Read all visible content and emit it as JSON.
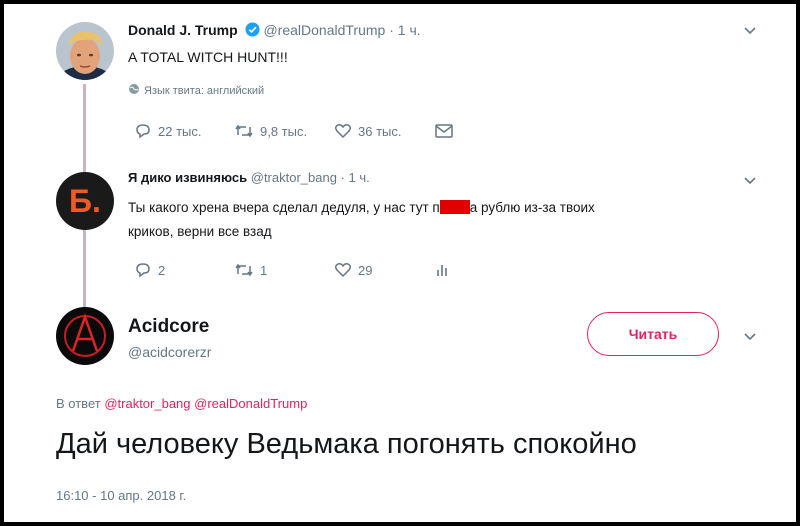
{
  "tweet1": {
    "name": "Donald J. Trump",
    "handle": "@realDonaldTrump",
    "time": "· 1 ч.",
    "text": "A TOTAL WITCH HUNT!!!",
    "translate": "Язык твита: английский",
    "replies": "22 тыс.",
    "retweets": "9,8 тыс.",
    "likes": "36 тыс."
  },
  "tweet2": {
    "name": "Я дико извиняюсь",
    "handle": "@traktor_bang",
    "time": "· 1 ч.",
    "text_line1_a": "Ты какого хрена вчера сделал дедуля, у нас тут п",
    "text_line1_b": "а рублю из-за твоих",
    "text_line2": "криков, верни все взад",
    "avatar_letter": "Б.",
    "replies": "2",
    "retweets": "1",
    "likes": "29"
  },
  "main": {
    "name": "Acidcore",
    "handle": "@acidcorerzr",
    "follow_label": "Читать",
    "reply_prefix": "В ответ",
    "reply_user1": "@traktor_bang",
    "reply_user2": "@realDonaldTrump",
    "text": "Дай человеку Ведьмака погонять спокойно",
    "timestamp": "16:10 - 10 апр. 2018 г."
  },
  "colors": {
    "accent": "#e0245e",
    "verified": "#1da1f2",
    "thread_line": "#c9b4c6",
    "avatar2_bg": "#1a1a1a",
    "avatar2_letter": "#f15a22"
  }
}
